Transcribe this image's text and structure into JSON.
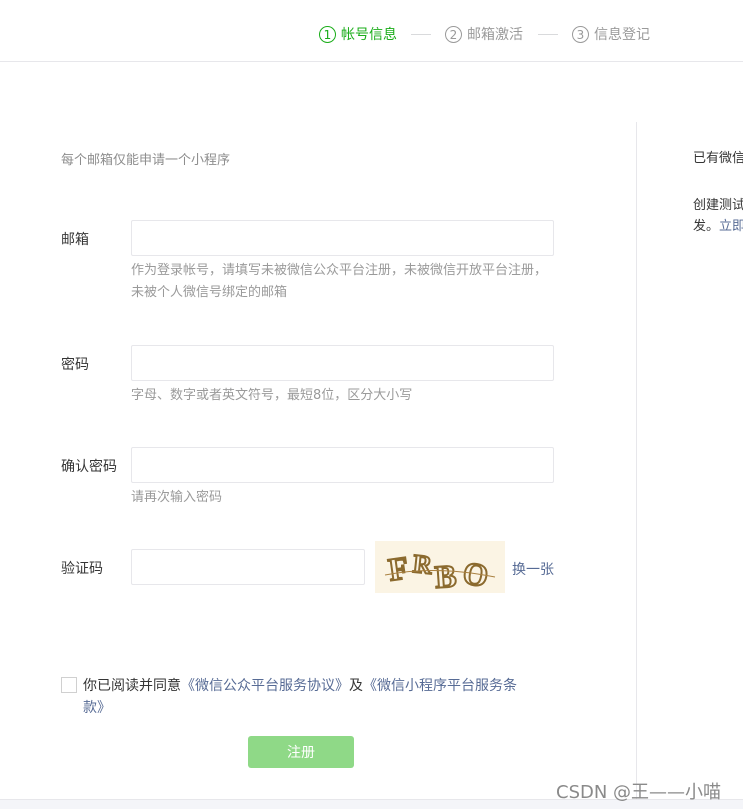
{
  "steps": [
    {
      "number": "1",
      "label": "帐号信息"
    },
    {
      "number": "2",
      "label": "邮箱激活"
    },
    {
      "number": "3",
      "label": "信息登记"
    }
  ],
  "colors": {
    "accent": "#1aad19",
    "link": "#576b95",
    "button_disabled": "#8fd987"
  },
  "form": {
    "tip": "每个邮箱仅能申请一个小程序",
    "email": {
      "label": "邮箱",
      "value": "",
      "hint": "作为登录帐号，请填写未被微信公众平台注册，未被微信开放平台注册，未被个人微信号绑定的邮箱"
    },
    "password": {
      "label": "密码",
      "value": "",
      "hint": "字母、数字或者英文符号，最短8位，区分大小写"
    },
    "confirm_password": {
      "label": "确认密码",
      "value": "",
      "hint": "请再次输入密码"
    },
    "captcha": {
      "label": "验证码",
      "value": "",
      "image_text": "FRBO",
      "refresh": "换一张"
    },
    "agreement": {
      "prefix": "你已阅读并同意",
      "link1": "《微信公众平台服务协议》",
      "middle": "及",
      "link2": "《微信小程序平台服务条款》"
    },
    "submit": "注册"
  },
  "side": {
    "line1": "已有微信",
    "line2": "创建测试",
    "line3_prefix": "发。",
    "line3_link": "立即"
  },
  "watermark": "CSDN @王——小喵"
}
